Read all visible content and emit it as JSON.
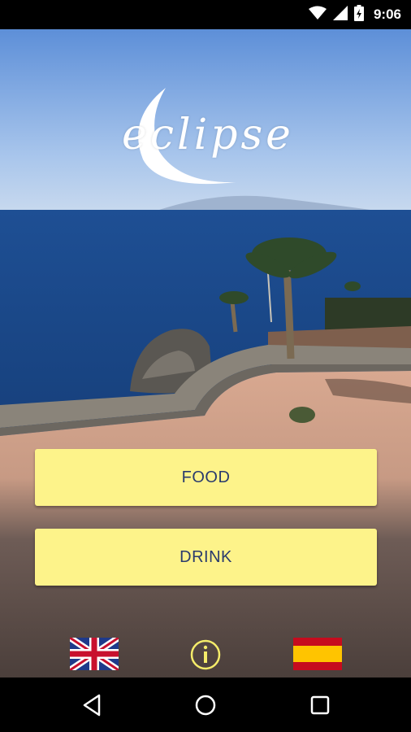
{
  "status_bar": {
    "time": "9:06",
    "icons": [
      "wifi-icon",
      "signal-icon",
      "battery-charging-icon"
    ]
  },
  "app": {
    "logo_text": "eclipse"
  },
  "menu": {
    "food_label": "FOOD",
    "drink_label": "DRINK"
  },
  "bottom_bar": {
    "icons": [
      "uk-flag-icon",
      "info-icon",
      "spain-flag-icon"
    ]
  },
  "nav_bar": {
    "icons": [
      "back-icon",
      "home-icon",
      "recents-icon"
    ]
  },
  "colors": {
    "button_bg": "#fdf38a",
    "button_text": "#2a3b6d",
    "info_icon": "#f5ec6a"
  }
}
